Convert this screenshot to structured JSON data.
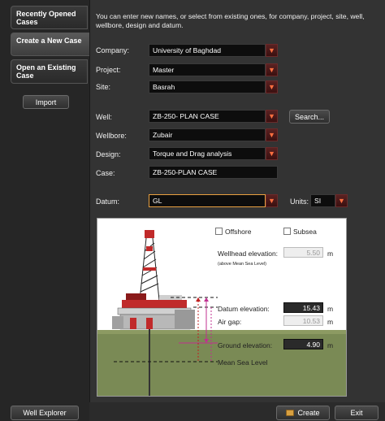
{
  "nav": {
    "tabs": [
      {
        "label": "Recently Opened Cases",
        "active": false
      },
      {
        "label": "Create a New Case",
        "active": true
      },
      {
        "label": "Open an Existing Case",
        "active": false
      }
    ],
    "import_label": "Import",
    "well_explorer_label": "Well Explorer"
  },
  "intro": "You can enter new names, or select from existing ones, for company, project, site, well, wellbore, design and datum.",
  "form": {
    "company": {
      "label": "Company:",
      "value": "University of Baghdad"
    },
    "project": {
      "label": "Project:",
      "value": "Master"
    },
    "site": {
      "label": "Site:",
      "value": "Basrah"
    },
    "well": {
      "label": "Well:",
      "value": "ZB-250- PLAN CASE"
    },
    "search_label": "Search...",
    "wellbore": {
      "label": "Wellbore:",
      "value": "Zubair"
    },
    "design": {
      "label": "Design:",
      "value": "Torque and Drag analysis"
    },
    "case": {
      "label": "Case:",
      "value": "ZB-250-PLAN CASE"
    },
    "datum": {
      "label": "Datum:",
      "value": "GL"
    },
    "units": {
      "label": "Units:",
      "value": "SI"
    }
  },
  "diagram": {
    "offshore_label": "Offshore",
    "offshore_checked": false,
    "subsea_label": "Subsea",
    "subsea_checked": false,
    "wellhead_label": "Wellhead elevation:",
    "wellhead_value": "5.50",
    "wellhead_unit": "m",
    "wellhead_note": "(above Mean Sea Level)",
    "datum_elev_label": "Datum elevation:",
    "datum_elev_value": "15.43",
    "datum_elev_unit": "m",
    "air_gap_label": "Air gap:",
    "air_gap_value": "10.53",
    "air_gap_unit": "m",
    "ground_label": "Ground elevation:",
    "ground_value": "4.90",
    "ground_unit": "m",
    "msl_label": "Mean Sea Level"
  },
  "footer": {
    "create_label": "Create",
    "exit_label": "Exit"
  },
  "colors": {
    "accent": "#e8a040",
    "dropdown_arrow": "#ff7040",
    "ground": "#7a8a55",
    "sea_line": "#111111",
    "datum_marker": "#c03090"
  }
}
